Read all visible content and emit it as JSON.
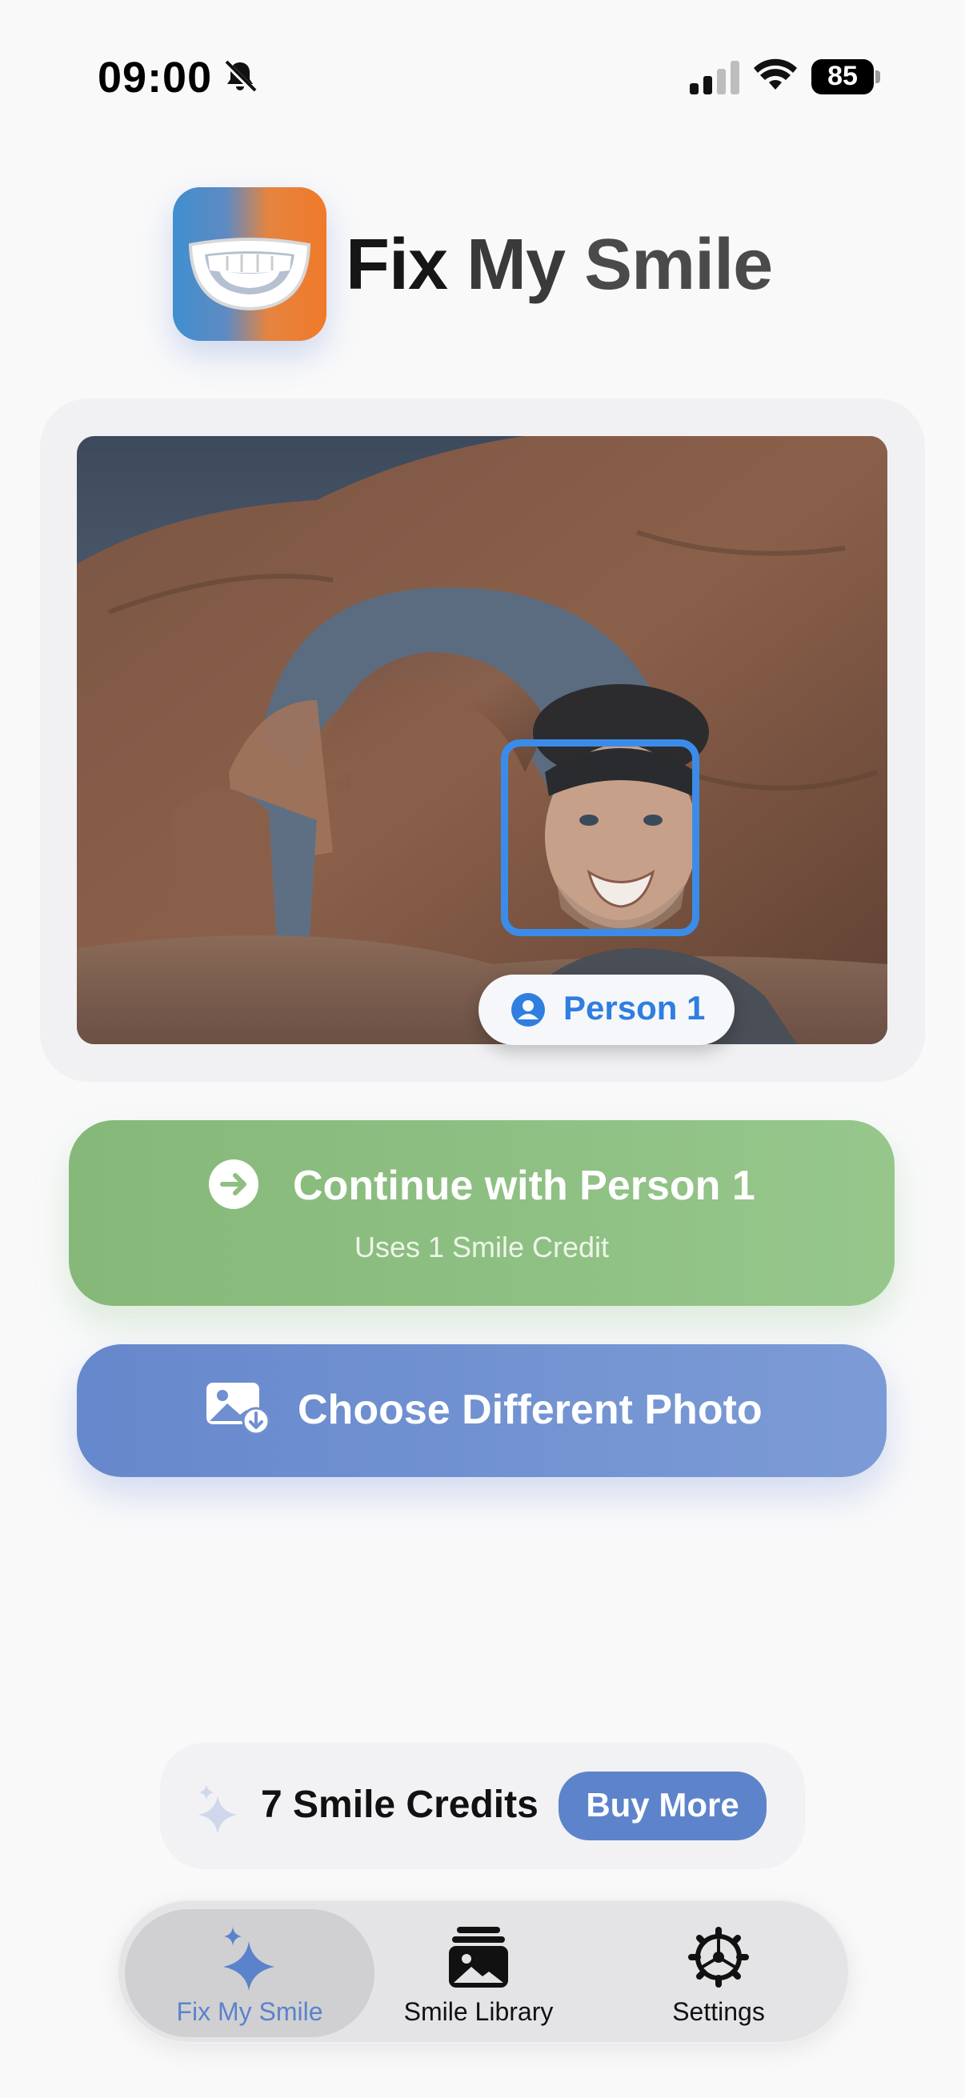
{
  "status_bar": {
    "time": "09:00",
    "battery": "85",
    "icons": [
      "bell-slash-icon",
      "cellular-signal-icon",
      "wifi-icon",
      "battery-icon"
    ]
  },
  "header": {
    "title_part1": "Fix ",
    "title_part2": "My ",
    "title_part3": "Smile",
    "icon": "smile-app-icon"
  },
  "photo": {
    "person_label": "Person 1",
    "icons": [
      "person-circle-icon"
    ]
  },
  "actions": {
    "continue_label": "Continue with Person 1",
    "continue_sub": "Uses 1 Smile Credit",
    "choose_label": "Choose Different Photo",
    "icons": [
      "arrow-right-circle-icon",
      "photo-download-icon"
    ]
  },
  "credits": {
    "label": "7 Smile Credits",
    "buy_label": "Buy More",
    "icon": "sparkles-icon"
  },
  "tab_bar": {
    "tabs": [
      {
        "label": "Fix My Smile",
        "icon": "sparkles-icon",
        "active": true
      },
      {
        "label": "Smile Library",
        "icon": "photo-stack-icon",
        "active": false
      },
      {
        "label": "Settings",
        "icon": "gear-icon",
        "active": false
      }
    ]
  },
  "colors": {
    "accent_blue": "#5b83cb",
    "continue_green": "#8ebf82",
    "face_box": "#3b8ce8"
  }
}
